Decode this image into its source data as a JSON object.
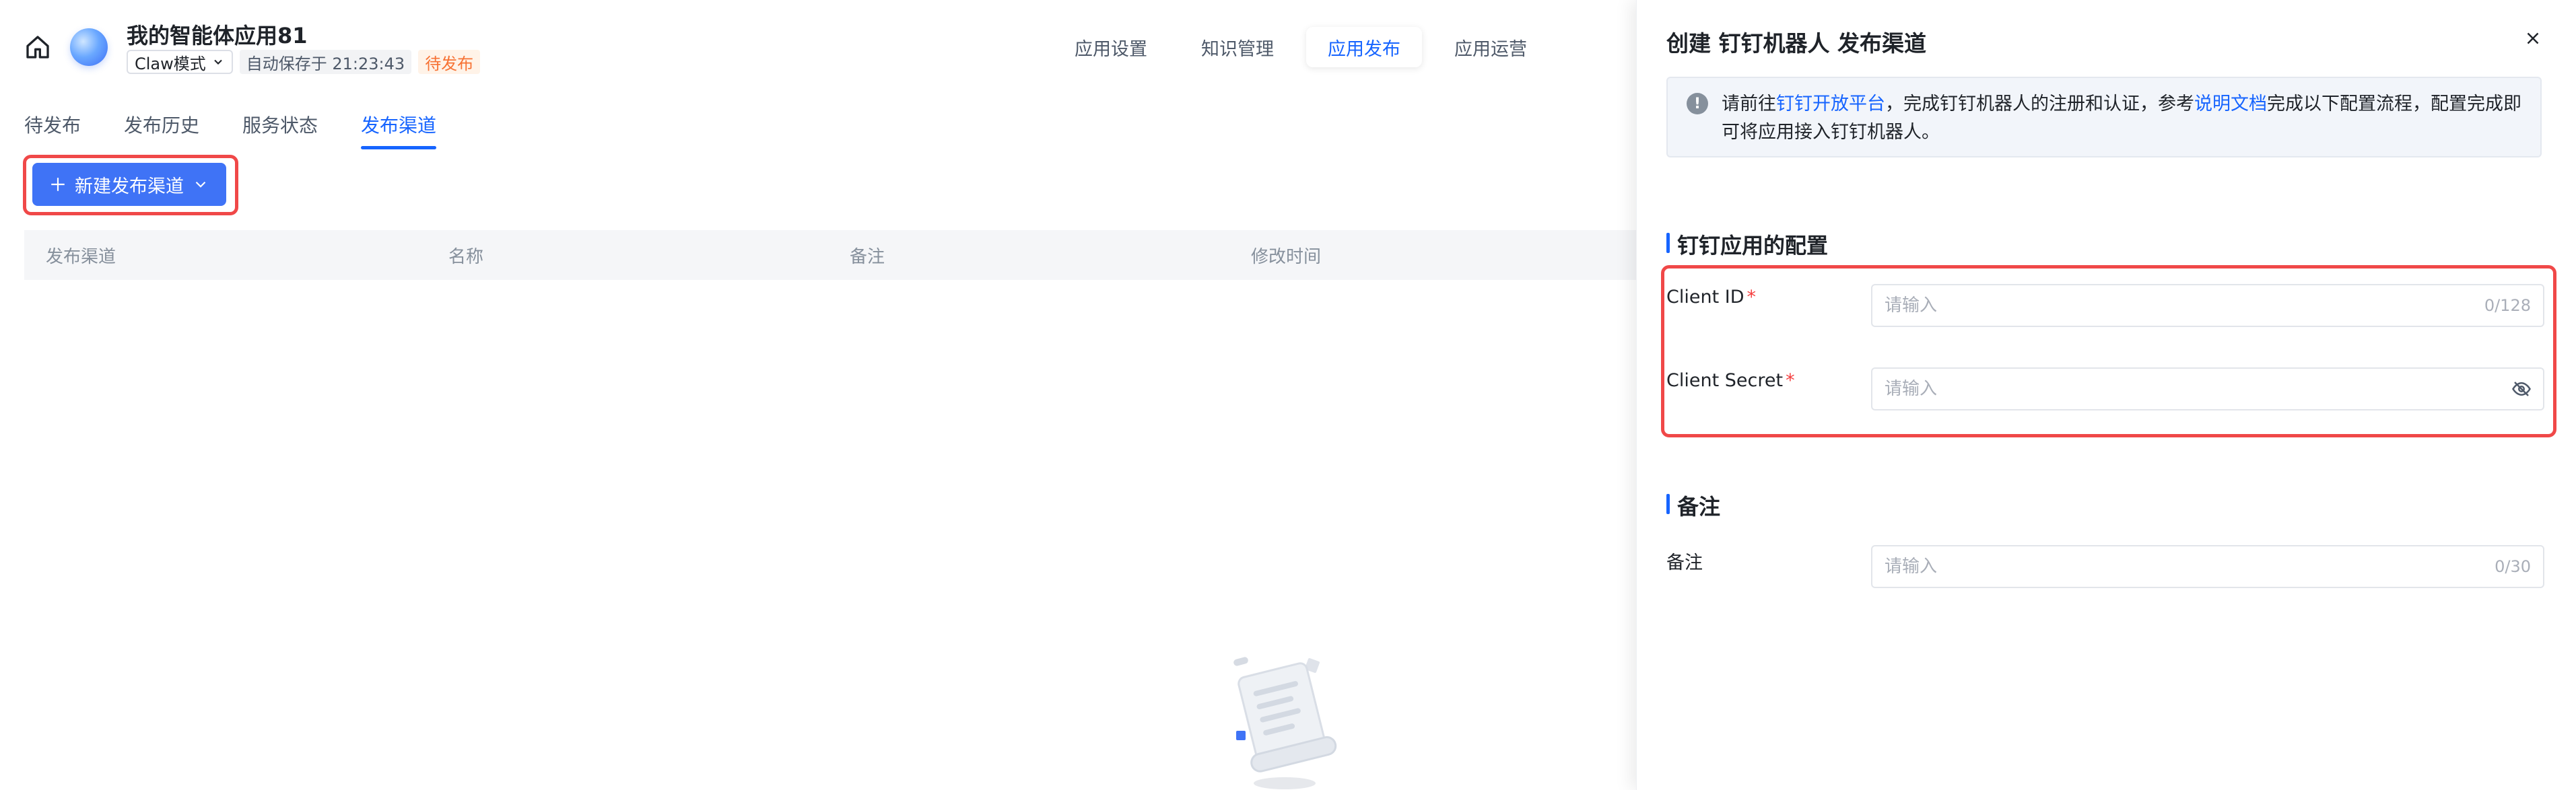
{
  "header": {
    "app_title": "我的智能体应用81",
    "mode": "Claw模式",
    "autosave": "自动保存于 21:23:43",
    "status": "待发布",
    "tabs": [
      {
        "label": "应用设置"
      },
      {
        "label": "知识管理"
      },
      {
        "label": "应用发布"
      },
      {
        "label": "应用运营"
      }
    ]
  },
  "subtabs": [
    {
      "label": "待发布"
    },
    {
      "label": "发布历史"
    },
    {
      "label": "服务状态"
    },
    {
      "label": "发布渠道"
    }
  ],
  "new_button": {
    "label": "新建发布渠道"
  },
  "table": {
    "columns": [
      "发布渠道",
      "名称",
      "备注",
      "修改时间"
    ]
  },
  "drawer": {
    "title": "创建 钉钉机器人 发布渠道",
    "notice": {
      "icon": "!",
      "part1": "请前往",
      "link1": "钉钉开放平台",
      "part2": "，完成钉钉机器人的注册和认证，参考",
      "link2": "说明文档",
      "part3": "完成以下配置流程，配置完成即可将应用接入钉钉机器人。"
    },
    "section1_title": "钉钉应用的配置",
    "client_id": {
      "label": "Client ID",
      "required": "*",
      "placeholder": "请输入",
      "counter": "0/128"
    },
    "client_secret": {
      "label": "Client Secret",
      "required": "*",
      "placeholder": "请输入"
    },
    "section2_title": "备注",
    "remark": {
      "label": "备注",
      "placeholder": "请输入",
      "counter": "0/30"
    }
  },
  "colors": {
    "primary": "#1664ff",
    "button": "#3f73f6",
    "highlight": "#f04848",
    "pending": "#f77234"
  }
}
